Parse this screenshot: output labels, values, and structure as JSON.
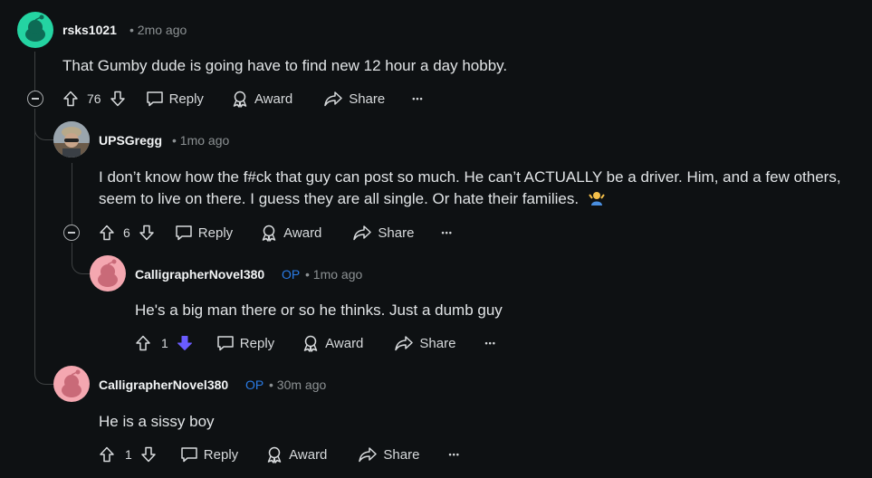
{
  "comments": [
    {
      "username": "rsks1021",
      "op_badge": "",
      "meta": "• 2mo ago",
      "body": "That Gumby dude is going have to find new 12 hour a day hobby.",
      "votes": "76",
      "avatar_color": "#24d4a2"
    },
    {
      "username": "UPSGregg",
      "op_badge": "",
      "meta": "• 1mo ago",
      "body_line1": "I don’t know how the f#ck that guy can post so much. He can’t ACTUALLY be a driver. Him, and a few others,",
      "body_line2": "seem to live on there. I guess they are all single. Or hate their families.",
      "votes": "6"
    },
    {
      "username": "CalligrapherNovel380",
      "op_badge": "OP",
      "meta": "• 1mo ago",
      "body": "He's a big man there or so he thinks. Just a dumb guy",
      "votes": "1",
      "avatar_color": "#f4a7b0"
    },
    {
      "username": "CalligrapherNovel380",
      "op_badge": "OP",
      "meta": "• 30m ago",
      "body": "He is a sissy boy",
      "votes": "1",
      "avatar_color": "#f4a7b0"
    }
  ],
  "actions": {
    "reply": "Reply",
    "award": "Award",
    "share": "Share",
    "more": "•••"
  },
  "colors": {
    "background": "#0e1113",
    "downvote_active": "#6a5cff",
    "op_badge": "#2a7be4"
  }
}
